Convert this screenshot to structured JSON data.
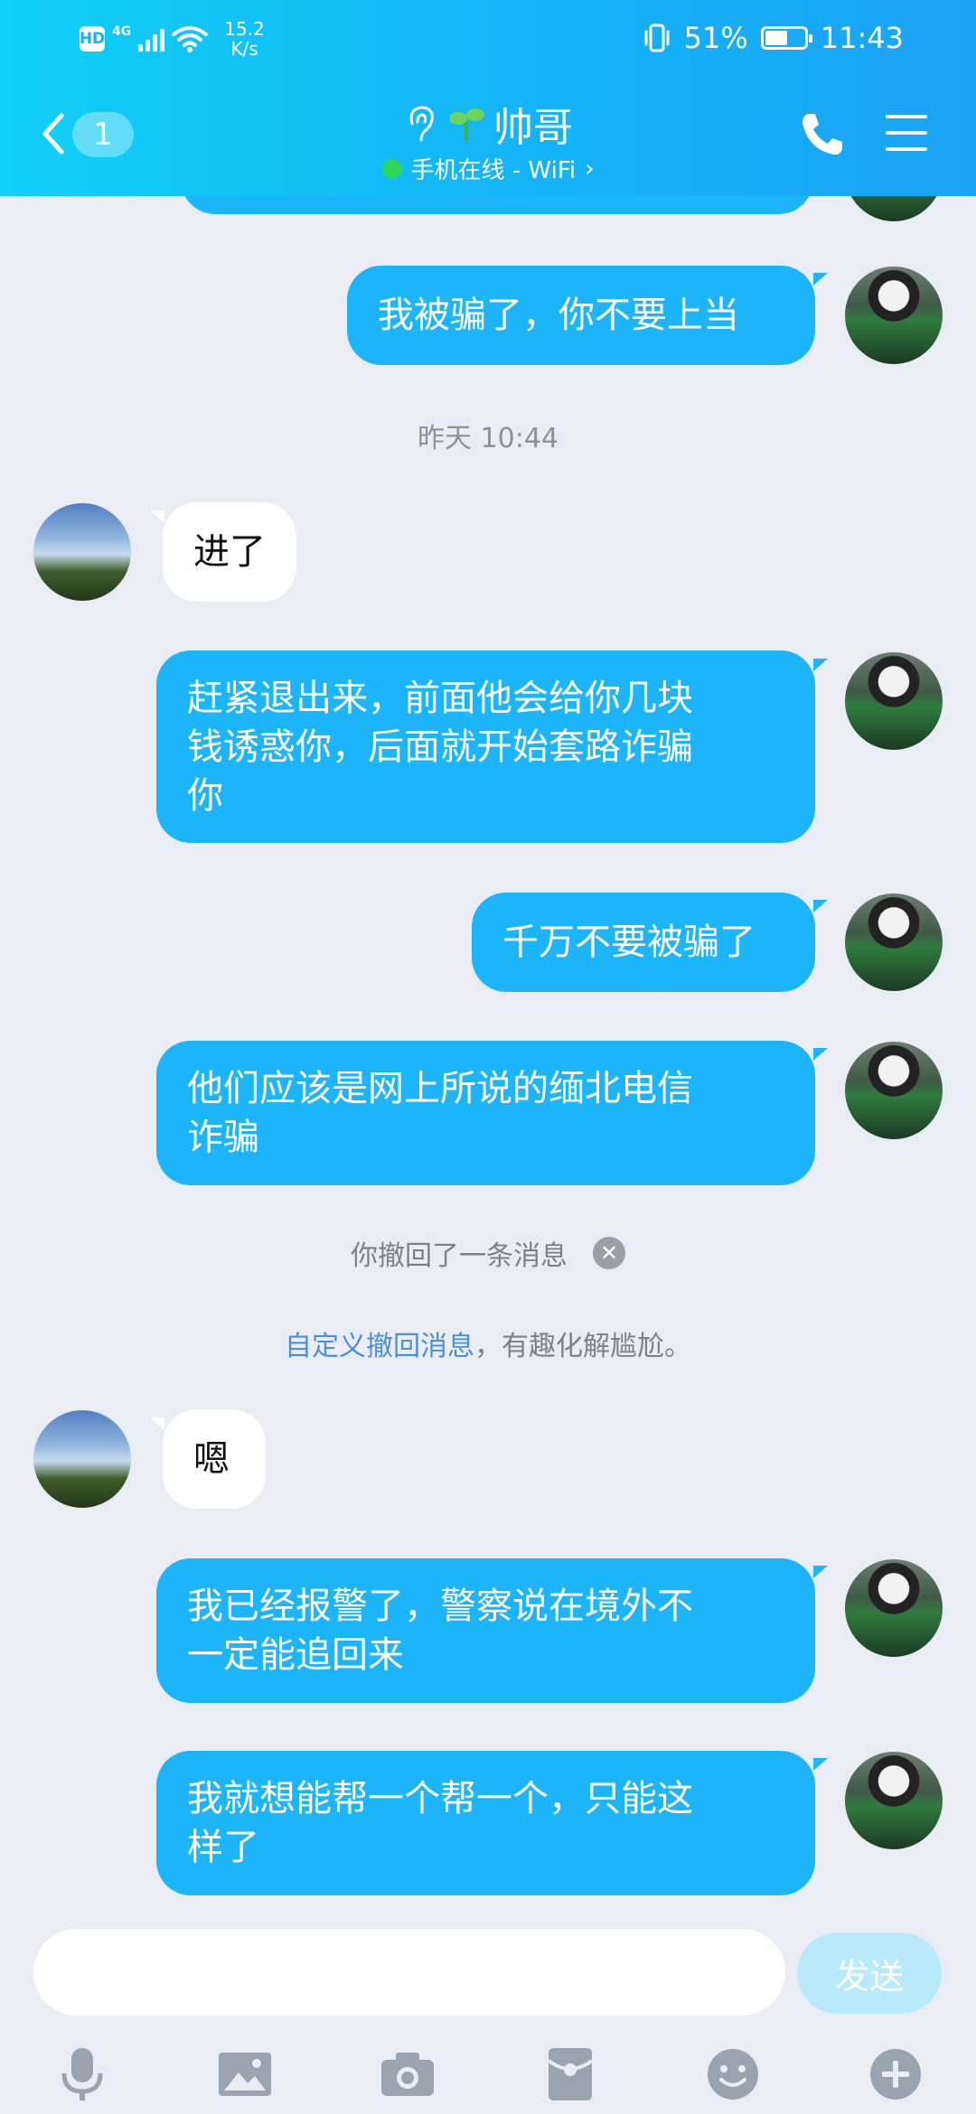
{
  "status_bar": {
    "hd": "HD",
    "net_type": "4G",
    "speed_value": "15.2",
    "speed_unit": "K/s",
    "battery": "51%",
    "time": "11:43"
  },
  "header": {
    "unread_count": "1",
    "contact_name": "帅哥",
    "online_status": "手机在线 - WiFi",
    "chevron": "›"
  },
  "messages": [
    {
      "dir": "out",
      "text": "我被骗了，你不要上当"
    },
    {
      "type": "timestamp",
      "text": "昨天 10:44"
    },
    {
      "dir": "in",
      "text": "进了"
    },
    {
      "dir": "out",
      "lines": [
        "赶紧退出来，前面他会给你几块",
        "钱诱惑你，后面就开始套路诈骗",
        "你"
      ]
    },
    {
      "dir": "out",
      "text": "千万不要被骗了"
    },
    {
      "dir": "out",
      "lines": [
        "他们应该是网上所说的缅北电信",
        "诈骗"
      ]
    },
    {
      "type": "recall",
      "text": "你撤回了一条消息"
    },
    {
      "type": "custom_recall",
      "link": "自定义撤回消息",
      "rest": "，有趣化解尴尬。"
    },
    {
      "dir": "in",
      "text": "嗯"
    },
    {
      "dir": "out",
      "lines": [
        "我已经报警了，警察说在境外不",
        "一定能追回来"
      ]
    },
    {
      "dir": "out",
      "lines": [
        "我就想能帮一个帮一个，只能这",
        "样了"
      ]
    }
  ],
  "input": {
    "placeholder": "",
    "send_label": "发送"
  },
  "toolbar_icons": [
    "microphone-icon",
    "image-icon",
    "camera-icon",
    "red-packet-icon",
    "emoji-icon",
    "plus-icon"
  ],
  "colors": {
    "header_start": "#0fd0f6",
    "header_end": "#1aa3f5",
    "outgoing_bubble": "#1db5fa",
    "incoming_bubble": "#ffffff",
    "background": "#eaedf4",
    "link": "#4a90d9",
    "online_dot": "#2bd65a",
    "send_disabled": "#b8eafc"
  }
}
